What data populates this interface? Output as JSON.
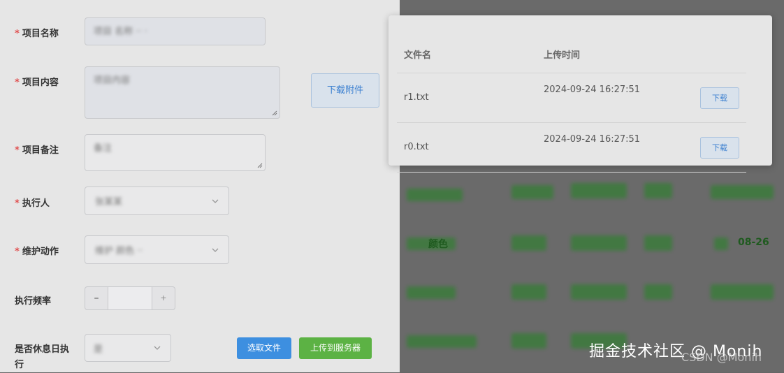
{
  "form": {
    "fields": [
      {
        "label": "项目名称",
        "required": true
      },
      {
        "label": "项目内容",
        "required": true
      },
      {
        "label": "项目备注",
        "required": true
      },
      {
        "label": "执行人",
        "required": true
      },
      {
        "label": "维护动作",
        "required": true
      },
      {
        "label": "执行频率",
        "required": false
      },
      {
        "label": "是否休息日执行",
        "required": false
      }
    ],
    "stepper_minus": "–",
    "download_attachment_label": "下载附件",
    "select_file_label": "选取文件",
    "upload_label": "上传到服务器"
  },
  "attachments": {
    "headers": {
      "name": "文件名",
      "time": "上传时间"
    },
    "rows": [
      {
        "name": "r1.txt",
        "time": "2024-09-24 16:27:51",
        "action": "下载"
      },
      {
        "name": "r0.txt",
        "time": "2024-09-24 16:27:51",
        "action": "下载"
      }
    ]
  },
  "background_table": {
    "visible_fragments": [
      "08-26",
      "颜色"
    ]
  },
  "watermark": {
    "main": "掘金技术社区 @ Monih",
    "sub": "CSDN @Monih"
  },
  "colors": {
    "primary": "#3d8fe0",
    "success": "#5cb244",
    "required": "#e05050"
  },
  "icons": {
    "select_arrow": "chevron-down-icon",
    "textarea_resize": "resize-handle-icon"
  }
}
